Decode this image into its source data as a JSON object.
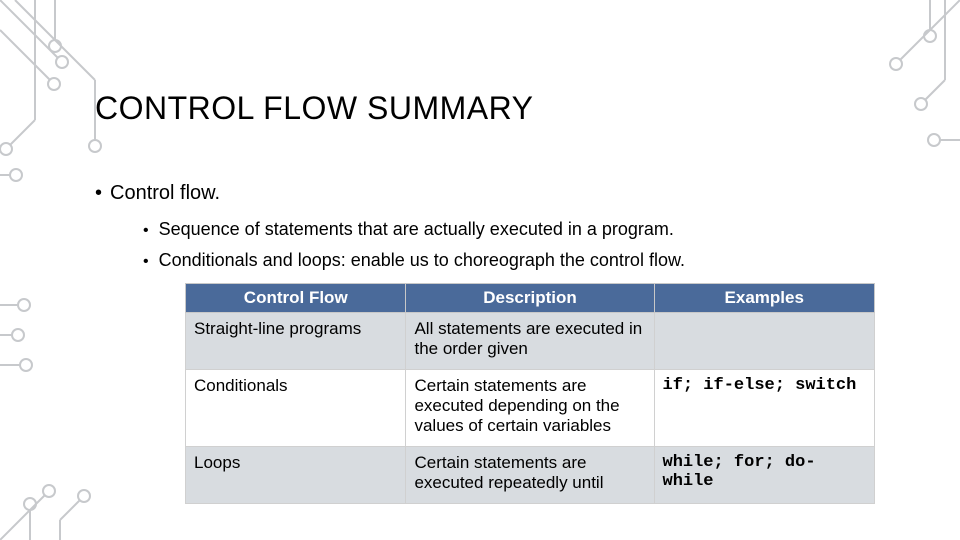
{
  "title": "CONTROL FLOW SUMMARY",
  "bullets": {
    "main": "Control flow.",
    "sub1": "Sequence of statements that are actually executed in a program.",
    "sub2": "Conditionals and loops:  enable us to choreograph the control flow."
  },
  "table": {
    "headers": {
      "c0": "Control Flow",
      "c1": "Description",
      "c2": "Examples"
    },
    "rows": [
      {
        "c0": "Straight-line programs",
        "c1": "All statements are executed in the order given",
        "c2": ""
      },
      {
        "c0": "Conditionals",
        "c1": "Certain statements are executed depending on the values of certain variables",
        "c2": "if; if-else; switch"
      },
      {
        "c0": "Loops",
        "c1": "Certain statements are executed repeatedly until",
        "c2": "while; for; do-while"
      }
    ]
  }
}
